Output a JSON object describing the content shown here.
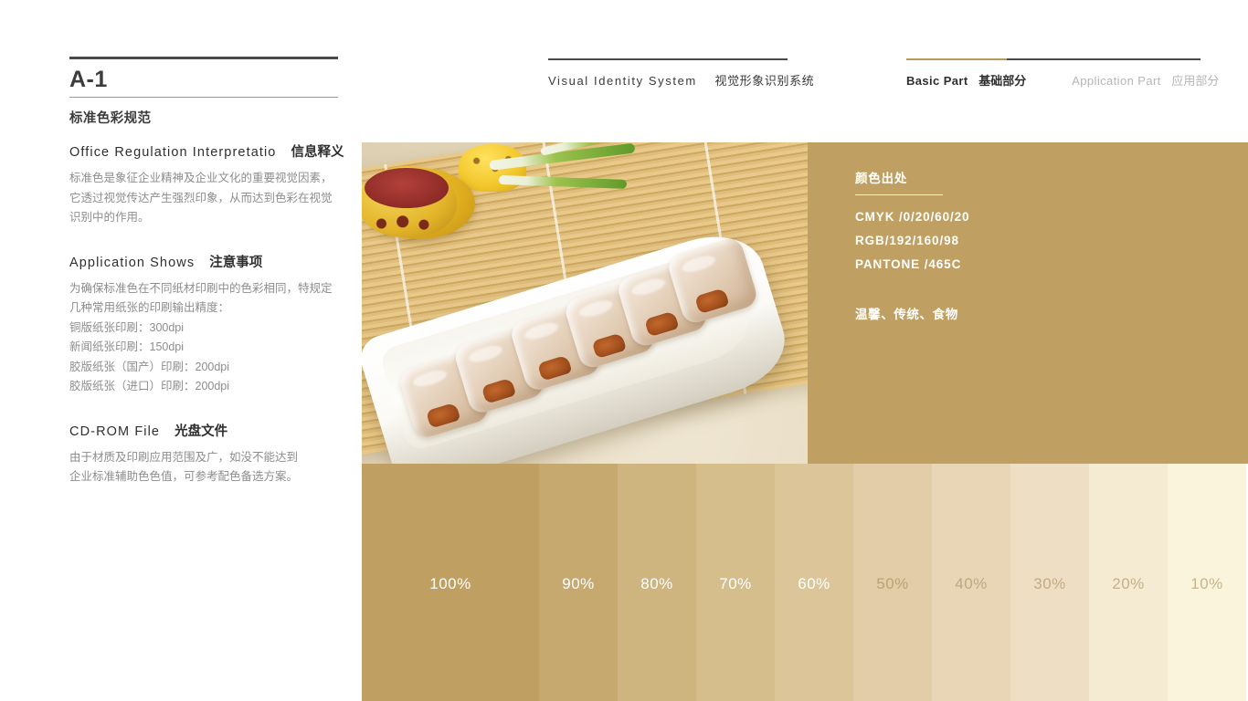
{
  "header": {
    "doc_code": "A-1",
    "doc_subtitle": "标准色彩规范",
    "system_en": "Visual  Identity  System",
    "system_cn": "视觉形象识别系统",
    "tabs": [
      {
        "en": "Basic Part",
        "cn": "基础部分",
        "active": true
      },
      {
        "en": "Application Part",
        "cn": "应用部分",
        "active": false
      }
    ]
  },
  "left_column": {
    "sections": [
      {
        "heading_en": "Office  Regulation  Interpretatio",
        "heading_cn": "信息释义",
        "lines": [
          "标准色是象征企业精神及企业文化的重要视觉因素，",
          "它透过视觉传达产生强烈印象，从而达到色彩在视觉",
          "识别中的作用。"
        ]
      },
      {
        "heading_en": "Application Shows",
        "heading_cn": "注意事项",
        "lines": [
          "为确保标准色在不同纸材印刷中的色彩相同，特规定",
          "几种常用纸张的印刷输出精度：",
          "铜版纸张印刷：300dpi",
          "新闻纸张印刷：150dpi",
          "胶版纸张（国产）印刷：200dpi",
          "胶版纸张（进口）印刷：200dpi"
        ]
      },
      {
        "heading_en": "CD-ROM File",
        "heading_cn": "光盘文件",
        "lines": [
          "由于材质及印刷应用范围及广，如没不能达到",
          "企业标准辅助色色值，可参考配色备选方案。"
        ]
      }
    ]
  },
  "spec_panel": {
    "title": "颜色出处",
    "lines": [
      "CMYK /0/20/60/20",
      "RGB/192/160/98",
      "PANTONE /465C"
    ],
    "keywords": "温馨、传统、食物",
    "background_color": "#c0a062"
  },
  "photo": {
    "alt": "白色长盘上的糯米卷点心，置于竹帘与茶杯旁"
  },
  "swatches": [
    {
      "label": "100%",
      "color": "#c0a062",
      "text_color": "#ffffff"
    },
    {
      "label": "90%",
      "color": "#c6a96f",
      "text_color": "#ffffff"
    },
    {
      "label": "80%",
      "color": "#ceb47f",
      "text_color": "#ffffff"
    },
    {
      "label": "70%",
      "color": "#d6bd8c",
      "text_color": "#ffffff"
    },
    {
      "label": "60%",
      "color": "#dcc599",
      "text_color": "#ffffff"
    },
    {
      "label": "50%",
      "color": "#e2cda8",
      "text_color": "#b9a276"
    },
    {
      "label": "40%",
      "color": "#e8d6b6",
      "text_color": "#bda97f"
    },
    {
      "label": "30%",
      "color": "#eedfc4",
      "text_color": "#c0ac83"
    },
    {
      "label": "20%",
      "color": "#f5ebd2",
      "text_color": "#c3b088"
    },
    {
      "label": "10%",
      "color": "#fbf4dd",
      "text_color": "#c6b48d"
    }
  ]
}
